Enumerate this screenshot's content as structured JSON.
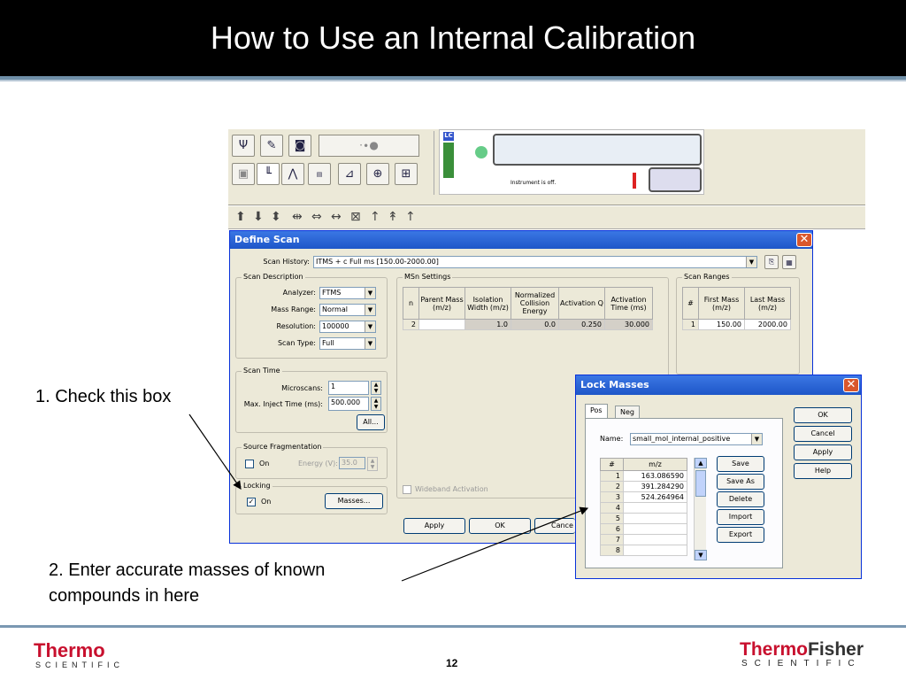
{
  "slide": {
    "title": "How to Use an Internal Calibration",
    "page_number": "12",
    "annotation_1": "1. Check this box",
    "annotation_2_line1": "2. Enter accurate masses of known",
    "annotation_2_line2": "compounds in here",
    "brand_left_name": "Thermo",
    "brand_left_sub": "SCIENTIFIC",
    "brand_right_name_a": "Thermo",
    "brand_right_name_b": "Fisher",
    "brand_right_sub": "SCIENTIFIC"
  },
  "instrument": {
    "status": "Instrument is off.",
    "lc_label": "LC"
  },
  "define_scan": {
    "title": "Define Scan",
    "scan_history_label": "Scan History:",
    "scan_history_value": "ITMS + c Full ms [150.00-2000.00]",
    "scan_description": {
      "group_label": "Scan Description",
      "analyzer_label": "Analyzer:",
      "analyzer_value": "FTMS",
      "mass_range_label": "Mass Range:",
      "mass_range_value": "Normal",
      "resolution_label": "Resolution:",
      "resolution_value": "100000",
      "scan_type_label": "Scan Type:",
      "scan_type_value": "Full"
    },
    "scan_time": {
      "group_label": "Scan Time",
      "microscans_label": "Microscans:",
      "microscans_value": "1",
      "max_inject_label": "Max. Inject Time (ms):",
      "max_inject_value": "500.000",
      "all_button": "All..."
    },
    "source_fragmentation": {
      "group_label": "Source Fragmentation",
      "on_label": "On",
      "energy_label": "Energy (V):",
      "energy_value": "35.0"
    },
    "locking": {
      "group_label": "Locking",
      "on_label": "On",
      "masses_button": "Masses..."
    },
    "msn_settings": {
      "group_label": "MSn Settings",
      "headers": [
        "n",
        "Parent Mass (m/z)",
        "Isolation Width (m/z)",
        "Normalized Collision Energy",
        "Activation Q",
        "Activation Time (ms)"
      ],
      "row": [
        "2",
        "",
        "1.0",
        "0.0",
        "0.250",
        "30.000"
      ],
      "wideband_label": "Wideband Activation"
    },
    "scan_ranges": {
      "group_label": "Scan Ranges",
      "headers": [
        "#",
        "First Mass (m/z)",
        "Last Mass (m/z)"
      ],
      "row": [
        "1",
        "150.00",
        "2000.00"
      ]
    },
    "apply_button": "Apply",
    "ok_button": "OK",
    "cancel_button": "Cance"
  },
  "lock_masses": {
    "title": "Lock Masses",
    "tabs": [
      "Pos",
      "Neg"
    ],
    "name_label": "Name:",
    "name_value": "small_mol_internal_positive",
    "table_headers": [
      "#",
      "m/z"
    ],
    "rows": [
      {
        "n": "1",
        "mz": "163.086590"
      },
      {
        "n": "2",
        "mz": "391.284290"
      },
      {
        "n": "3",
        "mz": "524.264964"
      },
      {
        "n": "4",
        "mz": ""
      },
      {
        "n": "5",
        "mz": ""
      },
      {
        "n": "6",
        "mz": ""
      },
      {
        "n": "7",
        "mz": ""
      },
      {
        "n": "8",
        "mz": ""
      }
    ],
    "save_button": "Save",
    "save_as_button": "Save As",
    "delete_button": "Delete",
    "import_button": "Import",
    "export_button": "Export",
    "ok_button": "OK",
    "cancel_button": "Cancel",
    "apply_button": "Apply",
    "help_button": "Help"
  }
}
